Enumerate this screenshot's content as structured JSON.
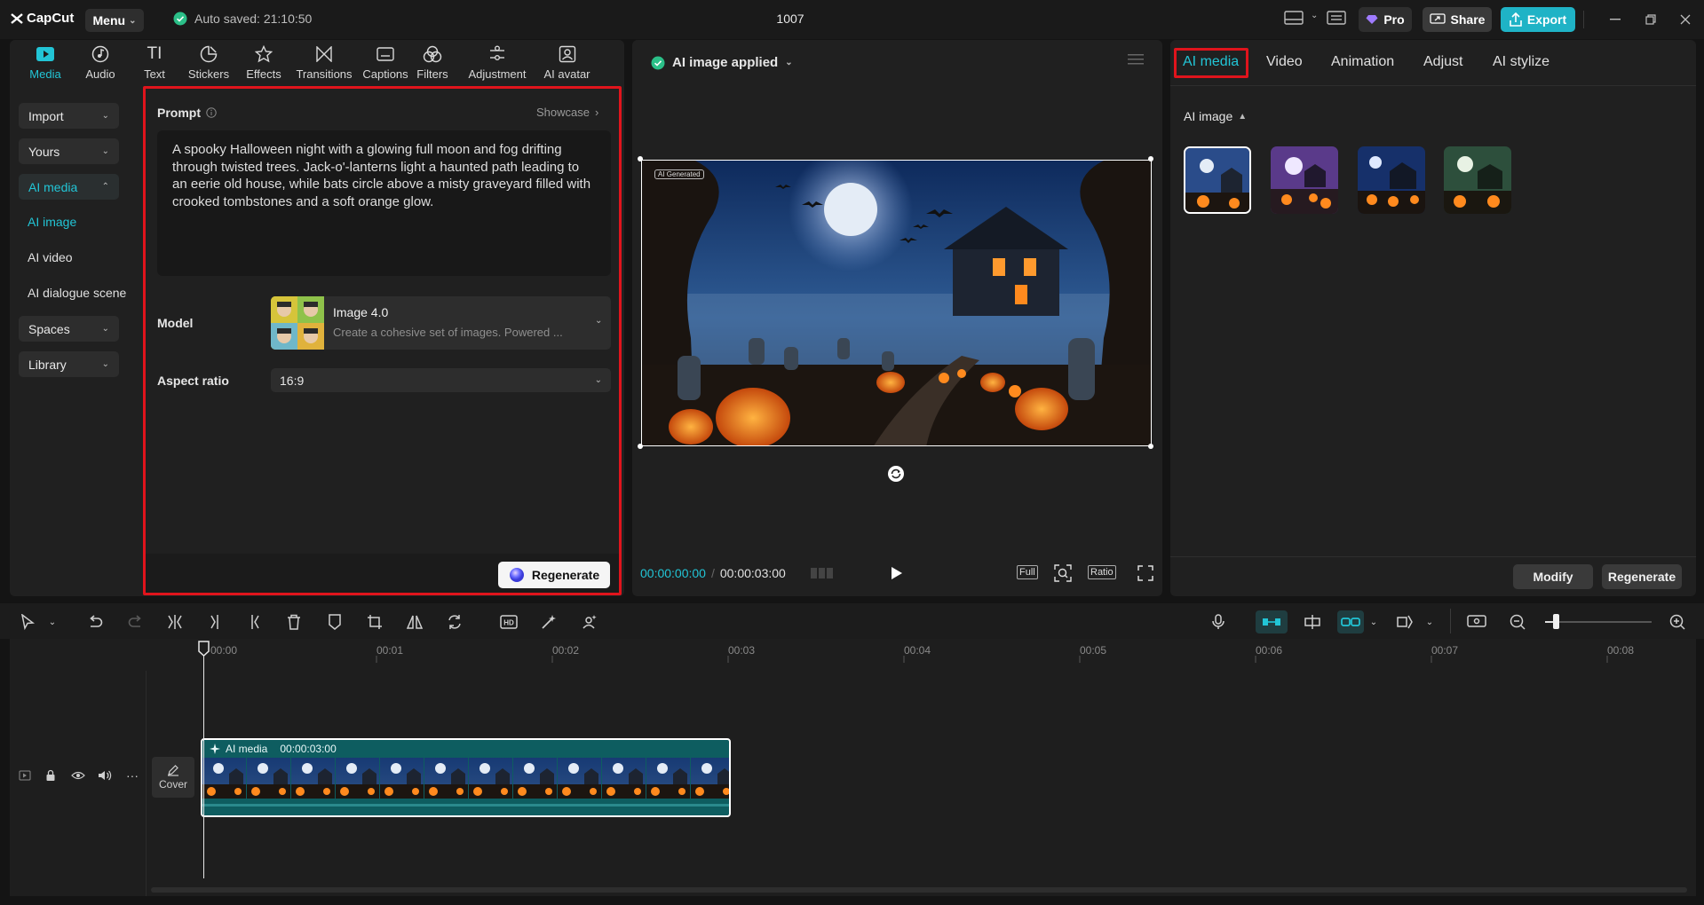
{
  "app": {
    "logo": "CapCut",
    "menu_label": "Menu",
    "autosave_text": "Auto saved: 21:10:50",
    "project_title": "1007",
    "pro_label": "Pro",
    "share_label": "Share",
    "export_label": "Export"
  },
  "toolbar": {
    "tools": [
      {
        "label": "Media",
        "icon": "media-icon",
        "active": true
      },
      {
        "label": "Audio",
        "icon": "audio-icon"
      },
      {
        "label": "Text",
        "icon": "text-icon"
      },
      {
        "label": "Stickers",
        "icon": "stickers-icon"
      },
      {
        "label": "Effects",
        "icon": "effects-icon"
      },
      {
        "label": "Transitions",
        "icon": "transitions-icon"
      },
      {
        "label": "Captions",
        "icon": "captions-icon"
      },
      {
        "label": "Filters",
        "icon": "filters-icon"
      },
      {
        "label": "Adjustment",
        "icon": "adjustment-icon"
      },
      {
        "label": "AI avatar",
        "icon": "ai-avatar-icon"
      }
    ]
  },
  "sidebar": {
    "import": "Import",
    "yours": "Yours",
    "ai_media": "AI media",
    "ai_image": "AI image",
    "ai_video": "AI video",
    "ai_dialogue": "AI dialogue scene",
    "spaces": "Spaces",
    "library": "Library"
  },
  "prompt_panel": {
    "prompt_label": "Prompt",
    "showcase": "Showcase",
    "prompt_text": "A spooky Halloween night with a glowing full moon and fog drifting through twisted trees. Jack-o'-lanterns light a haunted path leading to an eerie old house, while bats circle above a misty graveyard filled with crooked tombstones and a soft orange glow.",
    "model_label": "Model",
    "model_name": "Image 4.0",
    "model_desc": "Create a cohesive set of images. Powered ...",
    "aspect_label": "Aspect ratio",
    "aspect_value": "16:9",
    "regenerate": "Regenerate"
  },
  "player": {
    "status": "AI image applied",
    "watermark": "AI Generated",
    "time_current": "00:00:00:00",
    "time_total": "00:00:03:00",
    "full_label": "Full",
    "ratio_label": "Ratio"
  },
  "right_panel": {
    "tabs": [
      "AI media",
      "Video",
      "Animation",
      "Adjust",
      "AI stylize"
    ],
    "section": "AI image",
    "modify": "Modify",
    "regenerate": "Regenerate"
  },
  "timeline": {
    "ruler": [
      "00:00",
      "00:01",
      "00:02",
      "00:03",
      "00:04",
      "00:05",
      "00:06",
      "00:07",
      "00:08"
    ],
    "cover_label": "Cover",
    "clip_label": "AI media",
    "clip_duration": "00:00:03:00",
    "zoom_level": 0.1
  },
  "colors": {
    "accent": "#22c5d6",
    "export": "#1fb3c6",
    "highlight": "#e0141c"
  }
}
